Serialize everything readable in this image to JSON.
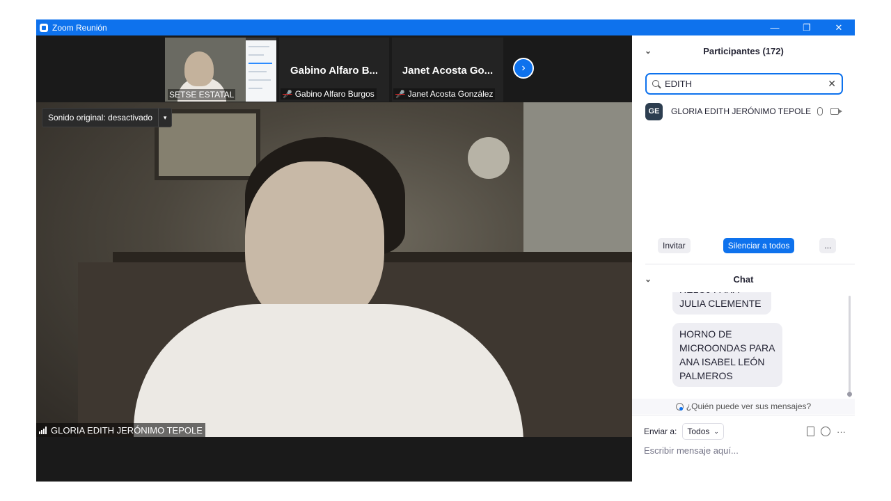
{
  "window": {
    "title": "Zoom Reunión",
    "controls": [
      "—",
      "❐",
      "✕"
    ]
  },
  "strip": {
    "tile1": {
      "label": "SETSE ESTATAL"
    },
    "tile2": {
      "name": "Gabino Alfaro B...",
      "label": "Gabino Alfaro Burgos"
    },
    "tile3": {
      "name": "Janet Acosta Go...",
      "label": "Janet Acosta González"
    },
    "next_glyph": "›"
  },
  "video": {
    "sound_label": "Sonido original: desactivado",
    "sound_caret": "▾",
    "speaker_name": "GLORIA EDITH JERÓNIMO TEPOLE"
  },
  "participants": {
    "title": "Participantes (172)",
    "collapse_glyph": "⌄",
    "search_value": "EDITH",
    "clear_glyph": "✕",
    "list": [
      {
        "initials": "GE",
        "name": "GLORIA EDITH JERÓNIMO TEPOLE"
      }
    ],
    "invite_label": "Invitar",
    "mute_all_label": "Silenciar a todos",
    "more_label": "..."
  },
  "chat": {
    "title": "Chat",
    "messages": [
      "RELOJ PARA JULIA CLEMENTE",
      "HORNO DE MICROONDAS PARA ANA ISABEL LEÓN PALMEROS"
    ],
    "who_can_see": "¿Quién puede ver sus mensajes?",
    "send_to_label": "Enviar a:",
    "send_to_value": "Todos",
    "placeholder": "Escribir mensaje aquí...",
    "more_glyph": "···"
  },
  "colors": {
    "zoom_blue": "#0e72ed",
    "video_bg": "#1a1a1a",
    "avatar_bg": "#2d3e50"
  }
}
